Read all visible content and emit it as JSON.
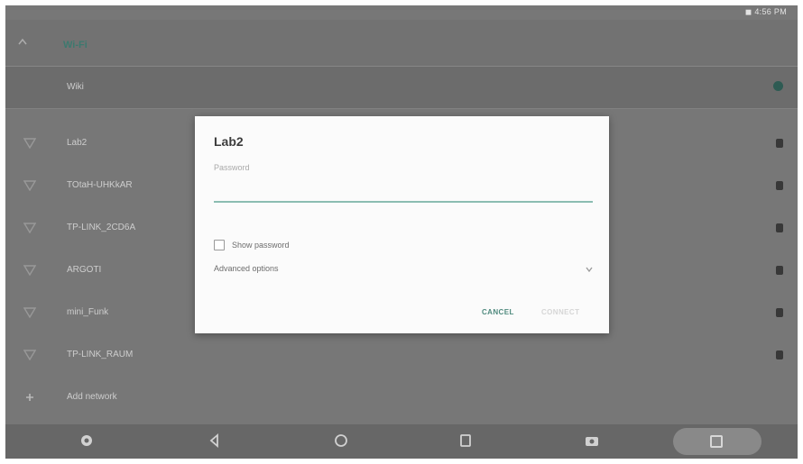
{
  "status_bar": {
    "time": "◼ 4:56 PM"
  },
  "wifi_header": {
    "label": "Wi-Fi"
  },
  "networks": [
    {
      "name": "Wiki",
      "current": true
    },
    {
      "name": "Lab2",
      "current": false
    },
    {
      "name": "TOtaH-UHKkAR",
      "current": false
    },
    {
      "name": "TP-LINK_2CD6A",
      "current": false
    },
    {
      "name": "ARGOTI",
      "current": false
    },
    {
      "name": "mini_Funk",
      "current": false
    },
    {
      "name": "TP-LINK_RAUM",
      "current": false
    },
    {
      "name": "Add network",
      "current": false
    }
  ],
  "dialog": {
    "title": "Lab2",
    "password_label": "Password",
    "password_value": "",
    "show_password_label": "Show password",
    "advanced_options_label": "Advanced options",
    "cancel_label": "CANCEL",
    "connect_label": "CONNECT"
  },
  "colors": {
    "accent": "#4f8a7e",
    "overlay": "#7a7a7a",
    "dialog_bg": "#fbfbfb"
  }
}
